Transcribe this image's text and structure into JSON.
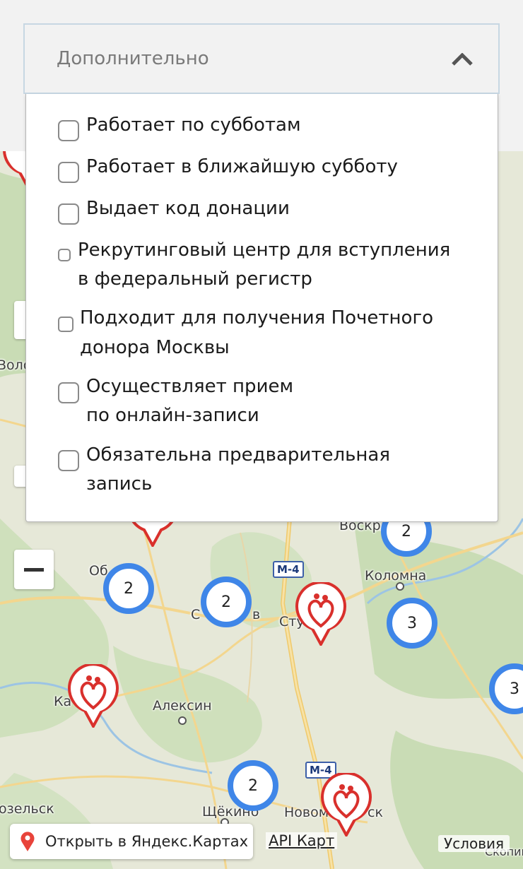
{
  "filter": {
    "title": "Дополнительно",
    "options": [
      {
        "line1": "Работает по субботам",
        "line2": ""
      },
      {
        "line1": "Работает в ближайшую субботу",
        "line2": ""
      },
      {
        "line1": "Выдает код донации",
        "line2": ""
      },
      {
        "line1": "Рекрутинговый центр для вступления",
        "line2": "в федеральный регистр"
      },
      {
        "line1": "Подходит для получения Почетного",
        "line2": "донора Москвы"
      },
      {
        "line1": "Осуществляет прием",
        "line2": "по онлайн-записи"
      },
      {
        "line1": "Обязательна предварительная",
        "line2": "запись"
      }
    ]
  },
  "map": {
    "places": [
      "Воло",
      "Коломна",
      "Воскр",
      "Об",
      "С",
      "в",
      "Сту",
      "Алексин",
      "Ка",
      "Щёкино",
      "Новомо",
      "ск",
      "озельск",
      "Скопин"
    ],
    "roads": [
      "М-4",
      "М-4"
    ],
    "clusters": [
      "2",
      "2",
      "2",
      "3",
      "3",
      "2"
    ],
    "open_link": "Открыть в Яндекс.Картах",
    "api_link": "API Карт",
    "terms": "Условия",
    "colors": {
      "cluster": "#3f86e8",
      "pin": "#d9302c",
      "forest": "#c9dcb5"
    }
  }
}
